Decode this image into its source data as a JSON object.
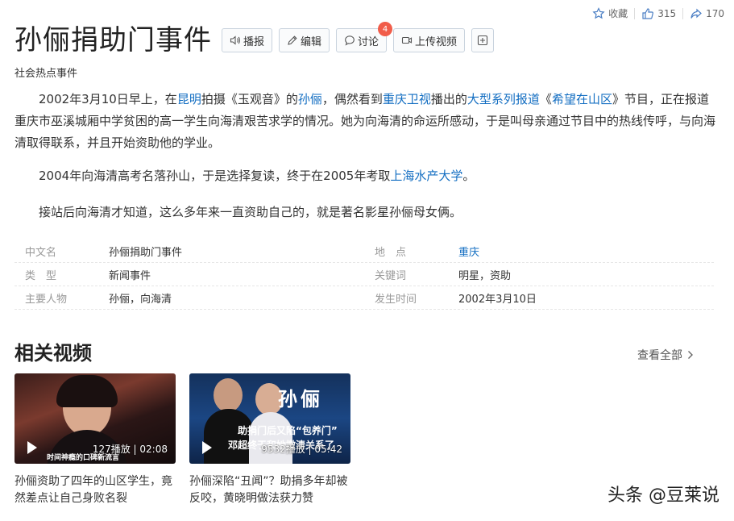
{
  "header": {
    "collect": {
      "label": "收藏"
    },
    "like": {
      "count": "315"
    },
    "share": {
      "count": "170"
    }
  },
  "title": "孙俪捐助门事件",
  "toolbar": {
    "broadcast": "播报",
    "edit": "编辑",
    "discuss": "讨论",
    "discuss_badge": "4",
    "upload": "上传视频"
  },
  "subtitle": "社会热点事件",
  "article": {
    "p1": {
      "t1": "2002年3月10日早上，在",
      "l1": "昆明",
      "t2": "拍摄《玉观音》的",
      "l2": "孙俪",
      "t3": "，偶然看到",
      "l3": "重庆卫视",
      "t4": "播出的",
      "l4": "大型系列报道",
      "t5": "《",
      "l5": "希望在山区",
      "t6": "》节目，正在报道重庆市巫溪城厢中学贫困的高一学生向海清艰苦求学的情况。她为向海清的命运所感动，于是叫母亲通过节目中的热线传呼，与向海清取得联系，并且开始资助他的学业。"
    },
    "p2": {
      "t1": "2004年向海清高考名落孙山，于是选择复读，终于在2005年考取",
      "l1": "上海水产大学",
      "t2": "。"
    },
    "p3": "接站后向海清才知道，这么多年来一直资助自己的，就是著名影星孙俪母女俩。"
  },
  "info": [
    {
      "k1": "中文名",
      "v1": "孙俪捐助门事件",
      "k2": "地　点",
      "v2": "重庆"
    },
    {
      "k1": "类　型",
      "v1": "新闻事件",
      "k2": "关键词",
      "v2": "明星，资助"
    },
    {
      "k1": "主要人物",
      "v1": "孙俪，向海清",
      "k2": "发生时间",
      "v2": "2002年3月10日"
    }
  ],
  "related": {
    "title": "相关视频",
    "see_all": "查看全部",
    "videos": [
      {
        "meta": "127播放 | 02:08",
        "title": "孙俪资助了四年的山区学生，竟然差点让自己身败名裂",
        "caption": "时间神瘾的口碑新流言"
      },
      {
        "meta": "9532播放 | 05:42",
        "title": "孙俪深陷“丑闻”？助捐多年却被反咬，黄晓明做法获力赞",
        "name": "孙俪",
        "line1": "助捐门后又陷“包养门”",
        "line2": "邓超终于和她撇清关系了"
      }
    ]
  },
  "watermark": "头条 @豆莱说"
}
